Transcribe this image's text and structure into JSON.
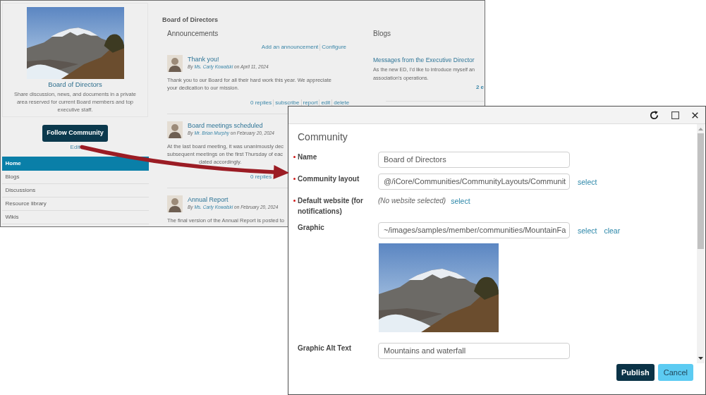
{
  "background_page": {
    "profile": {
      "title": "Board of Directors",
      "description": "Share discussion, news, and documents in a private area reserved for current Board members and top executive staff."
    },
    "follow_button": "Follow Community",
    "edit_link": "Edit",
    "nav": [
      {
        "label": "Home",
        "selected": true
      },
      {
        "label": "Blogs",
        "selected": false
      },
      {
        "label": "Discussions",
        "selected": false
      },
      {
        "label": "Resource library",
        "selected": false
      },
      {
        "label": "Wikis",
        "selected": false
      }
    ],
    "heading": "Board of Directors",
    "announcements": {
      "title": "Announcements",
      "links": [
        "Add an announcement",
        "Configure"
      ],
      "posts": [
        {
          "title": "Thank you!",
          "byline": {
            "prefix": "By",
            "author": "Ms. Carly Kowalski",
            "date": "on April 11, 2024"
          },
          "body_lines": [
            "Thank you to our Board for all their hard work this year. We appreciate",
            "your dedication to our mission."
          ],
          "actions": [
            "0 replies",
            "subscribe",
            "report",
            "edit",
            "delete"
          ]
        },
        {
          "title": "Board meetings scheduled",
          "byline": {
            "prefix": "By",
            "author": "Mr. Brian Murphy",
            "date": "on February 20, 2024"
          },
          "body_lines": [
            "At the last board meeting, it was unanimously dec",
            "subsequent meetings on the first Thursday of eac",
            "dated accordingly."
          ],
          "actions": [
            "0 replies"
          ]
        },
        {
          "title": "Annual Report",
          "byline": {
            "prefix": "By",
            "author": "Ms. Carly Kowalski",
            "date": "on February 20, 2024"
          },
          "body_lines": [
            "The final version of the Annual Report is posted to"
          ]
        }
      ]
    },
    "blogs": {
      "title": "Blogs",
      "posts": [
        {
          "title": "Messages from the Executive Director",
          "body_lines": [
            "As the new ED, I'd like to introduce myself an",
            "association's operations."
          ],
          "link": "2 e"
        }
      ]
    }
  },
  "dialog": {
    "title": "Community",
    "fields": [
      {
        "kind": "input",
        "label": "Name",
        "required": true,
        "value": "Board of Directors"
      },
      {
        "kind": "input",
        "label": "Community layout",
        "required": true,
        "value": "@/iCore/Communities/CommunityLayouts/Communit",
        "links": [
          "select"
        ]
      },
      {
        "kind": "text",
        "label": "Default website (for notifications)",
        "required": true,
        "value": "(No website selected)",
        "links": [
          "select"
        ]
      },
      {
        "kind": "image_input",
        "label": "Graphic",
        "required": false,
        "value": "~/images/samples/member/communities/MountainFa",
        "links": [
          "select",
          "clear"
        ]
      },
      {
        "kind": "input",
        "label": "Graphic Alt Text",
        "required": false,
        "value": "Mountains and waterfall"
      }
    ],
    "buttons": [
      {
        "label": "Publish",
        "kind": "primary"
      },
      {
        "label": "Cancel",
        "kind": "secondary"
      }
    ]
  }
}
